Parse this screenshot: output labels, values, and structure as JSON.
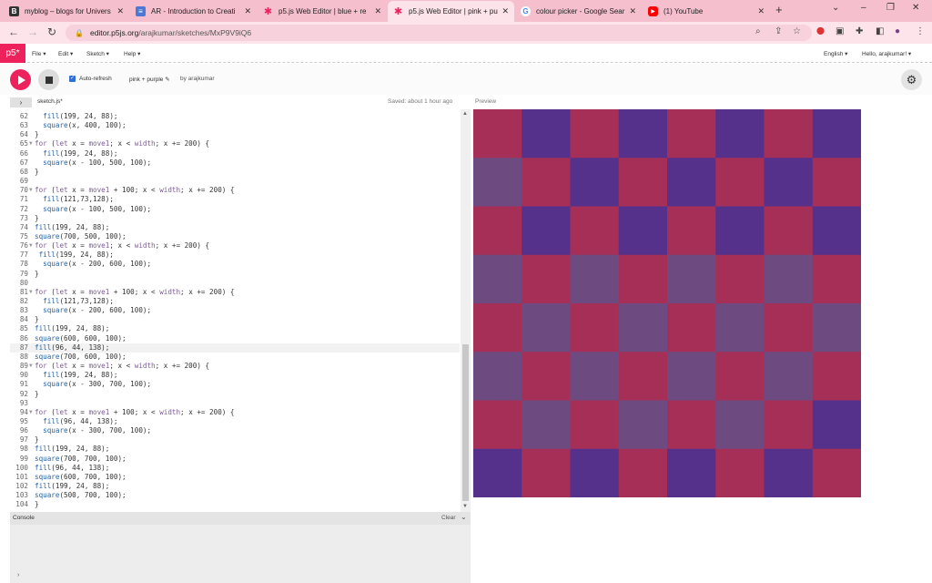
{
  "browser": {
    "tabs": [
      {
        "title": "myblog – blogs for Univers",
        "icon": "blogger-icon",
        "icon_color": "#333333",
        "glyph": "B"
      },
      {
        "title": "AR - Introduction to Creati",
        "icon": "google-docs-icon",
        "icon_color": "#4a78d4",
        "glyph": "≡"
      },
      {
        "title": "p5.js Web Editor | blue + re",
        "icon": "p5-asterisk-icon",
        "icon_color": "#ed225d",
        "glyph": "✱"
      },
      {
        "title": "p5.js Web Editor | pink + pu",
        "icon": "p5-asterisk-icon",
        "icon_color": "#ed225d",
        "glyph": "✱"
      },
      {
        "title": "colour picker - Google Sear",
        "icon": "google-icon",
        "icon_color": "#ffffff",
        "glyph": "G"
      },
      {
        "title": "(1) YouTube",
        "icon": "youtube-icon",
        "icon_color": "#ff0000",
        "glyph": "▶"
      }
    ],
    "active_tab": 3,
    "url_host": "editor.p5js.org",
    "url_path": "/arajkumar/sketches/MxP9V9iQ6"
  },
  "p5": {
    "logo": "p5*",
    "menu": [
      "File ▾",
      "Edit ▾",
      "Sketch ▾",
      "Help ▾"
    ],
    "language": "English ▾",
    "user": "Hello, arajkumar! ▾",
    "auto_refresh_label": "Auto-refresh",
    "sketch_name": "pink + purple ✎",
    "by_author": "by arajkumar",
    "file_name": "sketch.js*",
    "saved_status": "Saved: about 1 hour ago",
    "preview_label": "Preview",
    "console_label": "Console",
    "clear_label": "Clear",
    "console_prompt": "›"
  },
  "code": [
    {
      "n": "62",
      "t": "  fill(199, 24, 88);"
    },
    {
      "n": "63",
      "t": "  square(x, 400, 100);"
    },
    {
      "n": "64",
      "t": "}"
    },
    {
      "n": "65",
      "t": "for (let x = move1; x < width; x += 200) {",
      "fold": true
    },
    {
      "n": "66",
      "t": "  fill(199, 24, 88);"
    },
    {
      "n": "67",
      "t": "  square(x - 100, 500, 100);"
    },
    {
      "n": "68",
      "t": "}"
    },
    {
      "n": "69",
      "t": ""
    },
    {
      "n": "70",
      "t": "for (let x = move1 + 100; x < width; x += 200) {",
      "fold": true
    },
    {
      "n": "71",
      "t": "  fill(121,73,128);"
    },
    {
      "n": "72",
      "t": "  square(x - 100, 500, 100);"
    },
    {
      "n": "73",
      "t": "}"
    },
    {
      "n": "74",
      "t": "fill(199, 24, 88);"
    },
    {
      "n": "75",
      "t": "square(700, 500, 100);"
    },
    {
      "n": "76",
      "t": "for (let x = move1; x < width; x += 200) {",
      "fold": true
    },
    {
      "n": "77",
      "t": " fill(199, 24, 88);"
    },
    {
      "n": "78",
      "t": "  square(x - 200, 600, 100);"
    },
    {
      "n": "79",
      "t": "}"
    },
    {
      "n": "80",
      "t": ""
    },
    {
      "n": "81",
      "t": "for (let x = move1 + 100; x < width; x += 200) {",
      "fold": true
    },
    {
      "n": "82",
      "t": "  fill(121,73,128);"
    },
    {
      "n": "83",
      "t": "  square(x - 200, 600, 100);"
    },
    {
      "n": "84",
      "t": "}"
    },
    {
      "n": "85",
      "t": "fill(199, 24, 88);"
    },
    {
      "n": "86",
      "t": "square(600, 600, 100);"
    },
    {
      "n": "87",
      "t": "fill(96, 44, 138);",
      "current": true
    },
    {
      "n": "88",
      "t": "square(700, 600, 100);"
    },
    {
      "n": "89",
      "t": "for (let x = move1; x < width; x += 200) {",
      "fold": true
    },
    {
      "n": "90",
      "t": "  fill(199, 24, 88);"
    },
    {
      "n": "91",
      "t": "  square(x - 300, 700, 100);"
    },
    {
      "n": "92",
      "t": "}"
    },
    {
      "n": "93",
      "t": ""
    },
    {
      "n": "94",
      "t": "for (let x = move1 + 100; x < width; x += 200) {",
      "fold": true
    },
    {
      "n": "95",
      "t": "  fill(96, 44, 138);"
    },
    {
      "n": "96",
      "t": "  square(x - 300, 700, 100);"
    },
    {
      "n": "97",
      "t": "}"
    },
    {
      "n": "98",
      "t": "fill(199, 24, 88);"
    },
    {
      "n": "99",
      "t": "square(700, 700, 100);"
    },
    {
      "n": "100",
      "t": "fill(96, 44, 138);"
    },
    {
      "n": "101",
      "t": "square(600, 700, 100);"
    },
    {
      "n": "102",
      "t": "fill(199, 24, 88);"
    },
    {
      "n": "103",
      "t": "square(500, 700, 100);"
    },
    {
      "n": "104",
      "t": "}"
    }
  ],
  "canvas": {
    "colors": {
      "R": "#a62f58",
      "P": "#55318b",
      "M": "#6d4a80"
    },
    "grid": [
      [
        "R",
        "P",
        "R",
        "P",
        "R",
        "P",
        "R",
        "P"
      ],
      [
        "M",
        "R",
        "P",
        "R",
        "P",
        "R",
        "P",
        "R"
      ],
      [
        "R",
        "P",
        "R",
        "P",
        "R",
        "P",
        "R",
        "P"
      ],
      [
        "M",
        "R",
        "M",
        "R",
        "M",
        "R",
        "M",
        "R"
      ],
      [
        "R",
        "M",
        "R",
        "M",
        "R",
        "M",
        "R",
        "M"
      ],
      [
        "M",
        "R",
        "M",
        "R",
        "M",
        "R",
        "M",
        "R"
      ],
      [
        "R",
        "M",
        "R",
        "M",
        "R",
        "M",
        "R",
        "P"
      ],
      [
        "P",
        "R",
        "P",
        "R",
        "P",
        "R",
        "P",
        "R"
      ]
    ]
  },
  "theme": {
    "accent": "#ed225d",
    "tab_strip": "#f5bfce",
    "toolbar": "#fde3ea"
  }
}
